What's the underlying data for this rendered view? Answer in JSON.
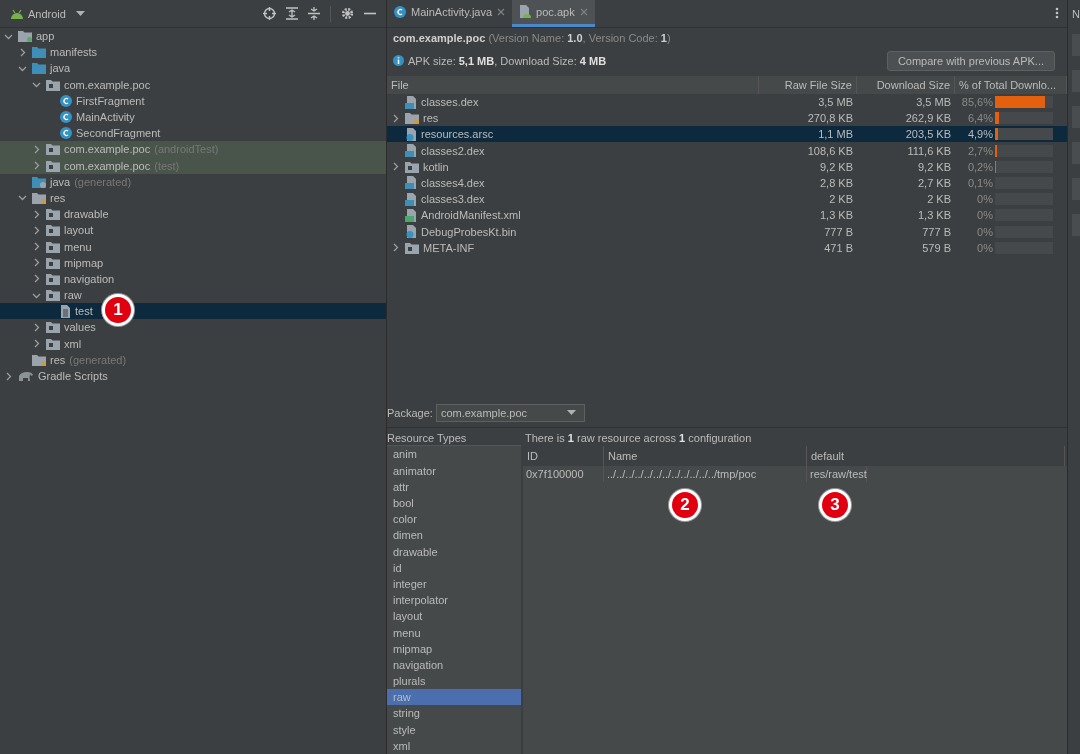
{
  "project_panel": {
    "view": "Android",
    "tree": [
      {
        "label": "app",
        "kind": "module",
        "expanded": true,
        "children": [
          {
            "label": "manifests",
            "kind": "folder",
            "expanded": false
          },
          {
            "label": "java",
            "kind": "folder",
            "expanded": true,
            "children": [
              {
                "label": "com.example.poc",
                "kind": "package",
                "expanded": true,
                "children": [
                  {
                    "label": "FirstFragment",
                    "kind": "class"
                  },
                  {
                    "label": "MainActivity",
                    "kind": "class"
                  },
                  {
                    "label": "SecondFragment",
                    "kind": "class"
                  }
                ]
              },
              {
                "label": "com.example.poc",
                "suffix": "(androidTest)",
                "kind": "package",
                "expanded": false,
                "highlighted": true
              },
              {
                "label": "com.example.poc",
                "suffix": "(test)",
                "kind": "package",
                "expanded": false,
                "highlighted": true
              }
            ]
          },
          {
            "label": "java",
            "suffix": "(generated)",
            "kind": "generated"
          },
          {
            "label": "res",
            "kind": "resfolder",
            "expanded": true,
            "children": [
              {
                "label": "drawable",
                "kind": "package",
                "expanded": false
              },
              {
                "label": "layout",
                "kind": "package",
                "expanded": false
              },
              {
                "label": "menu",
                "kind": "package",
                "expanded": false
              },
              {
                "label": "mipmap",
                "kind": "package",
                "expanded": false
              },
              {
                "label": "navigation",
                "kind": "package",
                "expanded": false
              },
              {
                "label": "raw",
                "kind": "package",
                "expanded": true,
                "children": [
                  {
                    "label": "test",
                    "kind": "file",
                    "selected": true
                  }
                ]
              },
              {
                "label": "values",
                "kind": "package",
                "expanded": false
              },
              {
                "label": "xml",
                "kind": "package",
                "expanded": false
              }
            ]
          },
          {
            "label": "res",
            "suffix": "(generated)",
            "kind": "resfolder"
          }
        ]
      },
      {
        "label": "Gradle Scripts",
        "kind": "gradle",
        "expanded": false
      }
    ]
  },
  "editor_tabs": [
    {
      "label": "MainActivity.java",
      "kind": "class",
      "selected": false
    },
    {
      "label": "poc.apk",
      "kind": "apk",
      "selected": true
    }
  ],
  "apk_header": {
    "package_line": "**com.example.poc** (Version Name: **1.0**, Version Code: **1**)",
    "size_line": "APK size: **5,1 MB**, Download Size: **4 MB**",
    "compare_button": "Compare with previous APK..."
  },
  "apk_table": {
    "columns": [
      "File",
      "Raw File Size",
      "Download Size",
      "% of Total Downlo..."
    ],
    "rows": [
      {
        "name": "classes.dex",
        "kind": "dex",
        "raw": "3,5 MB",
        "download": "3,5 MB",
        "percent": "85,6%",
        "level": 0.856,
        "selected": false
      },
      {
        "name": "res",
        "kind": "resfolder",
        "expanded": false,
        "raw": "270,8 KB",
        "download": "262,9 KB",
        "percent": "6,4%",
        "level": 0.064,
        "selected": false
      },
      {
        "name": "resources.arsc",
        "kind": "unknown",
        "raw": "1,1 MB",
        "download": "203,5 KB",
        "percent": "4,9%",
        "level": 0.049,
        "selected": true
      },
      {
        "name": "classes2.dex",
        "kind": "dex",
        "raw": "108,6 KB",
        "download": "111,6 KB",
        "percent": "2,7%",
        "level": 0.027,
        "selected": false
      },
      {
        "name": "kotlin",
        "kind": "folder",
        "expanded": false,
        "raw": "9,2 KB",
        "download": "9,2 KB",
        "percent": "0,2%",
        "level": 0.002,
        "selected": false
      },
      {
        "name": "classes4.dex",
        "kind": "dex",
        "raw": "2,8 KB",
        "download": "2,7 KB",
        "percent": "0,1%",
        "level": 0.001,
        "selected": false
      },
      {
        "name": "classes3.dex",
        "kind": "dex",
        "raw": "2 KB",
        "download": "2 KB",
        "percent": "0%",
        "selected": false
      },
      {
        "name": "AndroidManifest.xml",
        "kind": "manifest",
        "raw": "1,3 KB",
        "download": "1,3 KB",
        "percent": "0%",
        "selected": false
      },
      {
        "name": "DebugProbesKt.bin",
        "kind": "unknown",
        "raw": "777 B",
        "download": "777 B",
        "percent": "0%",
        "selected": false
      },
      {
        "name": "META-INF",
        "kind": "folder",
        "expanded": false,
        "raw": "471 B",
        "download": "579 B",
        "percent": "0%",
        "selected": false
      }
    ]
  },
  "package_selector": {
    "label": "Package:",
    "value": "com.example.poc"
  },
  "resource_types": {
    "title": "Resource Types",
    "items": [
      {
        "label": "anim",
        "selected": false
      },
      {
        "label": "animator",
        "selected": false
      },
      {
        "label": "attr",
        "selected": false
      },
      {
        "label": "bool",
        "selected": false
      },
      {
        "label": "color",
        "selected": false
      },
      {
        "label": "dimen",
        "selected": false
      },
      {
        "label": "drawable",
        "selected": false
      },
      {
        "label": "id",
        "selected": false
      },
      {
        "label": "integer",
        "selected": false
      },
      {
        "label": "interpolator",
        "selected": false
      },
      {
        "label": "layout",
        "selected": false
      },
      {
        "label": "menu",
        "selected": false
      },
      {
        "label": "mipmap",
        "selected": false
      },
      {
        "label": "navigation",
        "selected": false
      },
      {
        "label": "plurals",
        "selected": false
      },
      {
        "label": "raw",
        "selected": true
      },
      {
        "label": "string",
        "selected": false
      },
      {
        "label": "style",
        "selected": false
      },
      {
        "label": "xml",
        "selected": false
      }
    ]
  },
  "resource_table": {
    "summary": "There is **1** raw resource across **1** configuration",
    "columns": [
      "ID",
      "Name",
      "default"
    ],
    "rows": [
      [
        "0x7f100000",
        "../../../../../../../../../../../../tmp/poc",
        "res/raw/test"
      ]
    ]
  },
  "right_strip": {
    "label": "N"
  },
  "annotations": [
    "1",
    "2",
    "3"
  ]
}
